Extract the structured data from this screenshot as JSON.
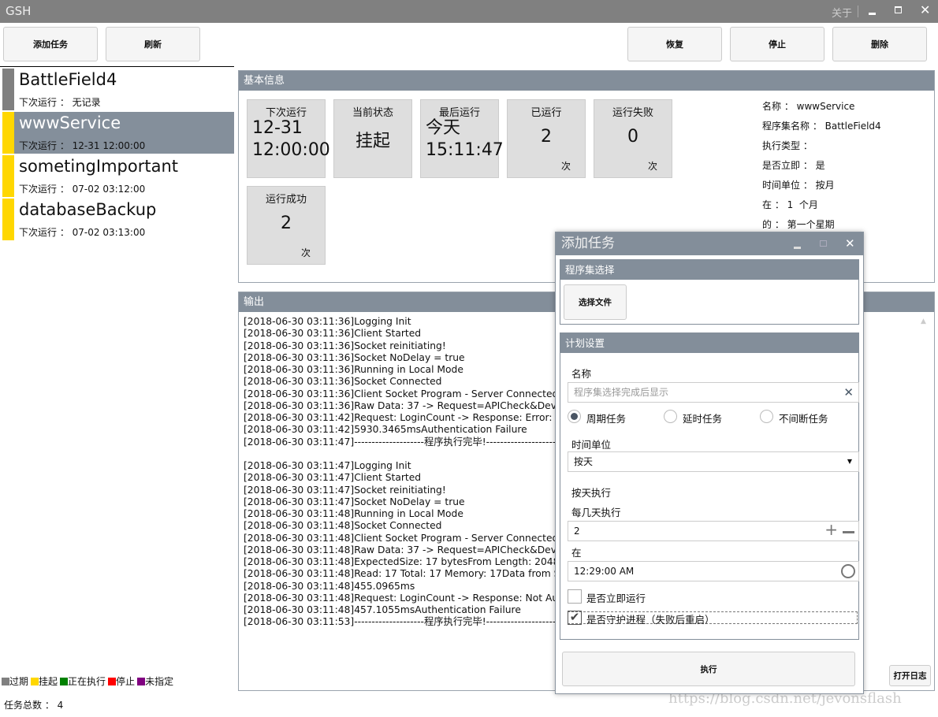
{
  "app": {
    "title": "GSH",
    "about": "关于"
  },
  "toolbar": {
    "add": "添加任务",
    "refresh": "刷新",
    "resume": "恢复",
    "stop": "停止",
    "delete": "删除"
  },
  "tasks": [
    {
      "name": "BattleField4",
      "next": "下次运行 ： 无记录",
      "color": "#808080"
    },
    {
      "name": "wwwService",
      "next": "下次运行 ： 12-31 12:00:00",
      "color": "#FFD700",
      "selected": true
    },
    {
      "name": "sometingImportant",
      "next": "下次运行 ： 07-02 03:12:00",
      "color": "#FFD700"
    },
    {
      "name": "databaseBackup",
      "next": "下次运行 ： 07-02 03:13:00",
      "color": "#FFD700"
    }
  ],
  "legend": [
    {
      "label": "过期",
      "color": "#808080"
    },
    {
      "label": "挂起",
      "color": "#FFD700"
    },
    {
      "label": "正在执行",
      "color": "#008000"
    },
    {
      "label": "停止",
      "color": "#FF0000"
    },
    {
      "label": "未指定",
      "color": "#800080"
    }
  ],
  "total": "任务总数 ： 4",
  "basic": {
    "header": "基本信息",
    "tiles": [
      {
        "title": "下次运行",
        "value": "12-31\n12:00:00",
        "unit": ""
      },
      {
        "title": "当前状态",
        "value": "挂起",
        "unit": ""
      },
      {
        "title": "最后运行",
        "value": "今天\n15:11:47",
        "unit": ""
      },
      {
        "title": "已运行",
        "value": "2",
        "unit": "次"
      },
      {
        "title": "运行失败",
        "value": "0",
        "unit": "次"
      },
      {
        "title": "运行成功",
        "value": "2",
        "unit": "次"
      }
    ],
    "info": [
      "名称 ： wwwService",
      "程序集名称 ： BattleField4",
      "执行类型 ：",
      "是否立即 ： 是",
      "时间单位 ： 按月",
      "在 ： 1  个月",
      "的 ： 第一个星期"
    ]
  },
  "output": {
    "header": "输出",
    "open_log": "打开日志",
    "lines": [
      "[2018-06-30 03:11:36]Logging Init",
      "[2018-06-30 03:11:36]Client Started",
      "[2018-06-30 03:11:36]Socket reinitiating!",
      "[2018-06-30 03:11:36]Socket NoDelay = true",
      "[2018-06-30 03:11:36]Running in Local Mode",
      "[2018-06-30 03:11:36]Socket Connected",
      "[2018-06-30 03:11:36]Client Socket Program - Server Connected ...",
      "[2018-06-30 03:11:36]Raw Data: 37 -> Request=APICheck&Device=B",
      "[2018-06-30 03:11:42]Request: LoginCount -> Response: Error: Serve",
      "[2018-06-30 03:11:42]5930.3465msAuthentication Failure",
      "[2018-06-30 03:11:47]--------------------程序执行完毕!--------------------",
      "",
      "[2018-06-30 03:11:47]Logging Init",
      "[2018-06-30 03:11:47]Client Started",
      "[2018-06-30 03:11:47]Socket reinitiating!",
      "[2018-06-30 03:11:47]Socket NoDelay = true",
      "[2018-06-30 03:11:48]Running in Local Mode",
      "[2018-06-30 03:11:48]Socket Connected",
      "[2018-06-30 03:11:48]Client Socket Program - Server Connected ...",
      "[2018-06-30 03:11:48]Raw Data: 37 -> Request=APICheck&Device=B",
      "[2018-06-30 03:11:48]ExpectedSize: 17 bytesFrom Length: 2048",
      "[2018-06-30 03:11:48]Read: 17 Total: 17 Memory: 17Data from Serve",
      "[2018-06-30 03:11:48]455.0965ms",
      "[2018-06-30 03:11:48]Request: LoginCount -> Response: Not Authen",
      "[2018-06-30 03:11:48]457.1055msAuthentication Failure",
      "[2018-06-30 03:11:53]--------------------程序执行完毕!--------------------"
    ]
  },
  "dialog": {
    "title": "添加任务",
    "assembly_header": "程序集选择",
    "choose_file": "选择文件",
    "plan_header": "计划设置",
    "name_label": "名称",
    "name_placeholder": "程序集选择完成后显示",
    "radios": [
      {
        "label": "周期任务",
        "checked": true
      },
      {
        "label": "延时任务",
        "checked": false
      },
      {
        "label": "不间断任务",
        "checked": false
      }
    ],
    "unit_label": "时间单位",
    "unit_value": "按天",
    "daily_label": "按天执行",
    "every_label": "每几天执行",
    "every_value": "2",
    "at_label": "在",
    "at_value": "12:29:00 AM",
    "immediate_label": "是否立即运行",
    "immediate_checked": false,
    "guard_label": "是否守护进程（失败后重启）",
    "guard_checked": true,
    "execute": "执行"
  },
  "watermark": "https://blog.csdn.net/jevonsflash"
}
